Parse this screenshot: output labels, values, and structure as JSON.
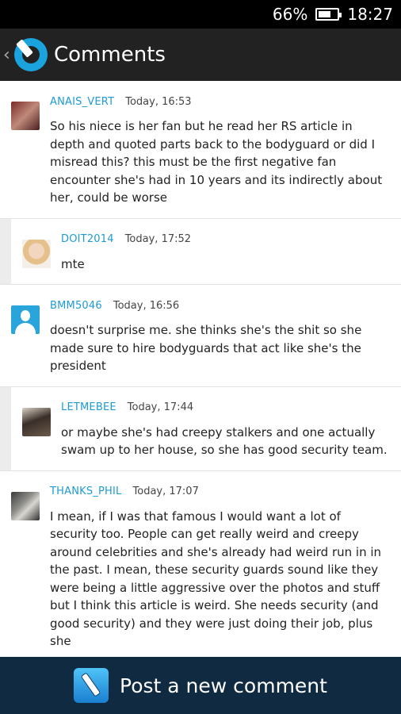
{
  "status_bar": {
    "battery": "66%",
    "battery_level": 0.66,
    "time": "18:27"
  },
  "app_bar": {
    "back": "‹",
    "title": "Comments"
  },
  "comments": [
    {
      "username": "ANAIS_VERT",
      "time": "Today, 16:53",
      "text": "So his niece is her fan but he read her RS article in depth and quoted parts back to the bodyguard or did I misread this? this must be the first negative fan encounter she's had in 10 years and its indirectly about her, could be worse"
    },
    {
      "username": "DOIT2014",
      "time": "Today, 17:52",
      "text": "mte"
    },
    {
      "username": "BMM5046",
      "time": "Today, 16:56",
      "text": "doesn't surprise me. she thinks she's the shit so she made sure to hire bodyguards that act like she's the president"
    },
    {
      "username": "LETMEBEE",
      "time": "Today, 17:44",
      "text": "or maybe she's had creepy stalkers and one actually swam up to her house, so she has good security team."
    },
    {
      "username": "THANKS_PHIL",
      "time": "Today, 17:07",
      "text": "I mean, if I was that famous I would want a lot of security too. People can get really weird and creepy around celebrities and she's already had weird run in in the past. I mean, these security guards sound like they were being a little aggressive over the photos and stuff but I think this article is weird. She needs security (and good security) and they were just doing their job, plus she"
    }
  ],
  "bottom_bar": {
    "label": "Post a new comment"
  }
}
